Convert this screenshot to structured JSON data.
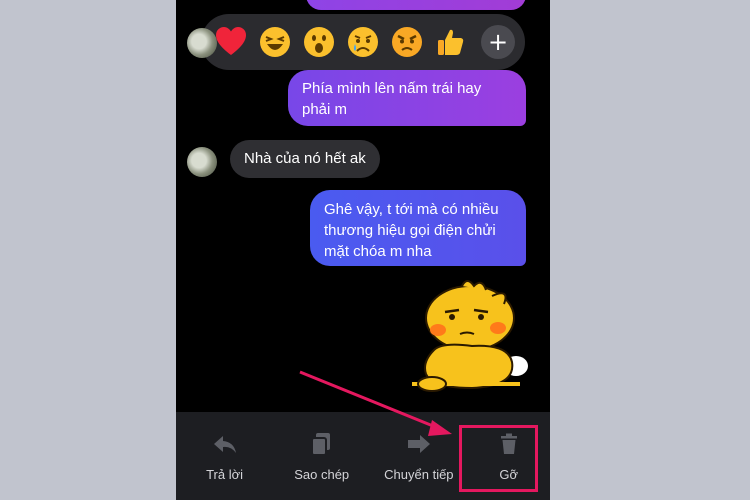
{
  "reactions": {
    "icons": [
      "heart-icon",
      "laughing-emoji-icon",
      "surprised-emoji-icon",
      "sad-emoji-icon",
      "angry-emoji-icon",
      "thumbs-up-icon"
    ],
    "more_label": "+"
  },
  "messages": [
    {
      "side": "right",
      "text": "Phía mình lên nấm trái hay phải m"
    },
    {
      "side": "left",
      "text": "Nhà của nó hết ak"
    },
    {
      "side": "right",
      "text": "Ghê vậy, t tới mà có nhiều thương hiệu gọi điện chửi mặt chóa m nha"
    }
  ],
  "action_bar": {
    "reply_label": "Trả lời",
    "copy_label": "Sao chép",
    "forward_label": "Chuyển tiếp",
    "remove_label": "Gỡ"
  },
  "colors": {
    "background": "#c1c4ce",
    "chat_bg": "#000000",
    "highlight": "#e4185f",
    "sent_bubble": "#7a4be6",
    "received_bubble": "#2f2f33"
  }
}
